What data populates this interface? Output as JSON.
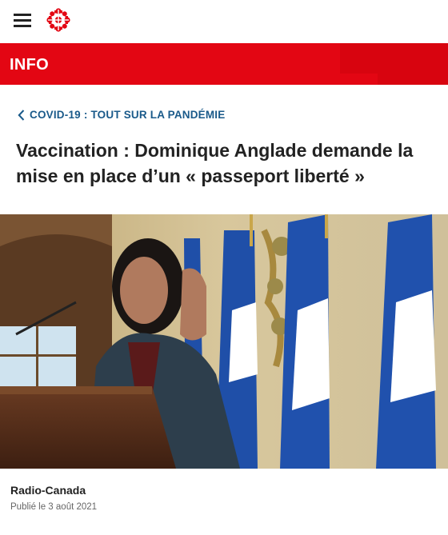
{
  "header": {
    "menu_icon": "hamburger-icon",
    "logo_icon": "radio-canada-gem-logo"
  },
  "section": {
    "label": "INFO",
    "color": "#e30613"
  },
  "breadcrumb": {
    "label": "COVID-19 : TOUT SUR LA PANDÉMIE",
    "icon": "chevron-left-icon",
    "color": "#1a5a8a"
  },
  "article": {
    "title": "Vaccination : Dominique Anglade demande la mise en place d’un « passeport liberté »",
    "source": "Radio-Canada",
    "published": "Publié le 3 août 2021"
  }
}
